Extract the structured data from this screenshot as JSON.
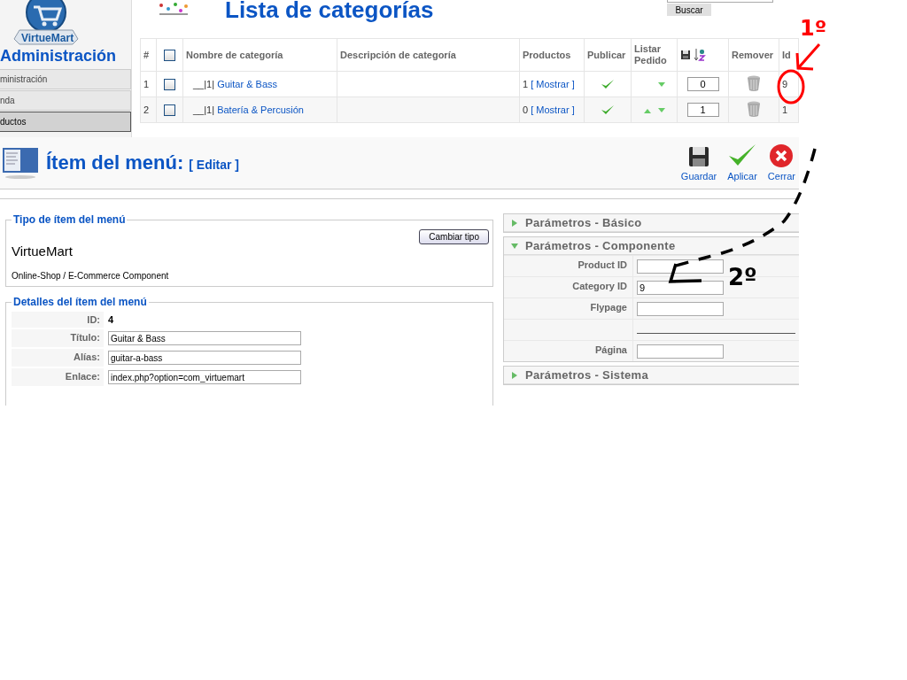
{
  "sidebar": {
    "logo_text": "VirtueMart",
    "heading": "Administración",
    "items": [
      {
        "label": "ministración",
        "selected": false
      },
      {
        "label": "nda",
        "selected": false
      },
      {
        "label": "ductos",
        "selected": true
      }
    ]
  },
  "category_list": {
    "title": "Lista de categorías",
    "search_button": "Buscar",
    "select_all_checked": false,
    "columns": [
      "#",
      "",
      "Nombre de categoría",
      "Descripción de categoría",
      "Productos",
      "Publicar",
      "Listar Pedido",
      "",
      "Remover",
      "Id"
    ],
    "rows": [
      {
        "number": "1",
        "checked": false,
        "prefix": "__|1|",
        "name": "Guitar & Bass",
        "product_count": "1",
        "show_link": "[ Mostrar ]",
        "published": true,
        "move_up": false,
        "move_down": true,
        "order": "0",
        "id": "9"
      },
      {
        "number": "2",
        "checked": false,
        "prefix": "__|1|",
        "name": "Batería & Percusión",
        "product_count": "0",
        "show_link": "[ Mostrar ]",
        "published": true,
        "move_up": true,
        "move_down": true,
        "order": "1",
        "id": "1"
      }
    ]
  },
  "menu_item_editor": {
    "title": "Ítem del menú:",
    "subtitle": "[ Editar ]",
    "toolbar": [
      {
        "kind": "save",
        "label": "Guardar"
      },
      {
        "kind": "apply",
        "label": "Aplicar"
      },
      {
        "kind": "close",
        "label": "Cerrar"
      }
    ],
    "type_box": {
      "legend": "Tipo de ítem del menú",
      "name": "VirtueMart",
      "description": "Online-Shop / E-Commerce Component",
      "button": "Cambiar tipo"
    },
    "details": {
      "legend": "Detalles del ítem del menú",
      "fields": [
        {
          "kind": "text",
          "label": "ID:",
          "value": "4"
        },
        {
          "kind": "input",
          "label": "Título:",
          "value": "Guitar & Bass"
        },
        {
          "kind": "input",
          "label": "Alías:",
          "value": "guitar-a-bass"
        },
        {
          "kind": "input",
          "label": "Enlace:",
          "value": "index.php?option=com_virtuemart"
        }
      ]
    },
    "parameter_panels": [
      {
        "title": "Parámetros - Básico",
        "expanded": false
      },
      {
        "title": "Parámetros - Componente",
        "expanded": true,
        "fields": [
          {
            "kind": "input",
            "label": "Product ID"
          },
          {
            "kind": "input",
            "label": "Category ID",
            "value": "9"
          },
          {
            "kind": "input",
            "label": "Flypage"
          },
          {
            "kind": "separator"
          },
          {
            "kind": "input",
            "label": "Página"
          }
        ]
      },
      {
        "title": "Parámetros - Sistema",
        "expanded": false
      }
    ]
  },
  "annotations": [
    {
      "kind": "first",
      "label": "1º"
    },
    {
      "kind": "second",
      "label": "2º"
    }
  ]
}
